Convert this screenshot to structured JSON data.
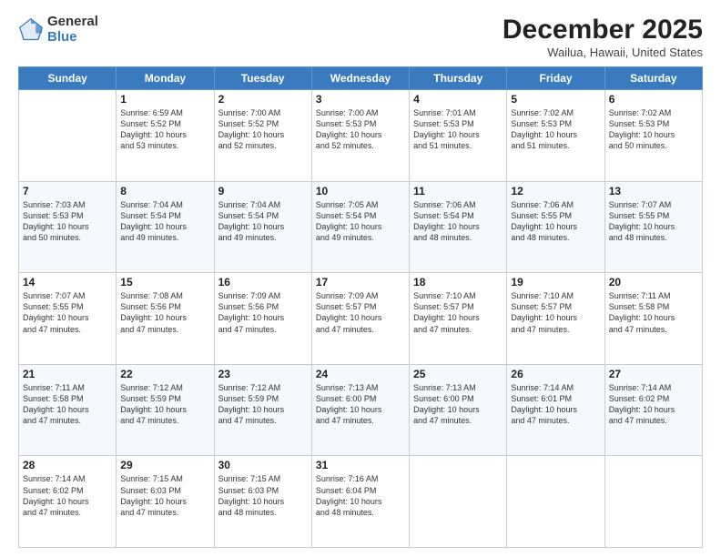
{
  "logo": {
    "general": "General",
    "blue": "Blue"
  },
  "header": {
    "month": "December 2025",
    "location": "Wailua, Hawaii, United States"
  },
  "weekdays": [
    "Sunday",
    "Monday",
    "Tuesday",
    "Wednesday",
    "Thursday",
    "Friday",
    "Saturday"
  ],
  "weeks": [
    [
      {
        "day": "",
        "info": ""
      },
      {
        "day": "1",
        "info": "Sunrise: 6:59 AM\nSunset: 5:52 PM\nDaylight: 10 hours\nand 53 minutes."
      },
      {
        "day": "2",
        "info": "Sunrise: 7:00 AM\nSunset: 5:52 PM\nDaylight: 10 hours\nand 52 minutes."
      },
      {
        "day": "3",
        "info": "Sunrise: 7:00 AM\nSunset: 5:53 PM\nDaylight: 10 hours\nand 52 minutes."
      },
      {
        "day": "4",
        "info": "Sunrise: 7:01 AM\nSunset: 5:53 PM\nDaylight: 10 hours\nand 51 minutes."
      },
      {
        "day": "5",
        "info": "Sunrise: 7:02 AM\nSunset: 5:53 PM\nDaylight: 10 hours\nand 51 minutes."
      },
      {
        "day": "6",
        "info": "Sunrise: 7:02 AM\nSunset: 5:53 PM\nDaylight: 10 hours\nand 50 minutes."
      }
    ],
    [
      {
        "day": "7",
        "info": "Sunrise: 7:03 AM\nSunset: 5:53 PM\nDaylight: 10 hours\nand 50 minutes."
      },
      {
        "day": "8",
        "info": "Sunrise: 7:04 AM\nSunset: 5:54 PM\nDaylight: 10 hours\nand 49 minutes."
      },
      {
        "day": "9",
        "info": "Sunrise: 7:04 AM\nSunset: 5:54 PM\nDaylight: 10 hours\nand 49 minutes."
      },
      {
        "day": "10",
        "info": "Sunrise: 7:05 AM\nSunset: 5:54 PM\nDaylight: 10 hours\nand 49 minutes."
      },
      {
        "day": "11",
        "info": "Sunrise: 7:06 AM\nSunset: 5:54 PM\nDaylight: 10 hours\nand 48 minutes."
      },
      {
        "day": "12",
        "info": "Sunrise: 7:06 AM\nSunset: 5:55 PM\nDaylight: 10 hours\nand 48 minutes."
      },
      {
        "day": "13",
        "info": "Sunrise: 7:07 AM\nSunset: 5:55 PM\nDaylight: 10 hours\nand 48 minutes."
      }
    ],
    [
      {
        "day": "14",
        "info": "Sunrise: 7:07 AM\nSunset: 5:55 PM\nDaylight: 10 hours\nand 47 minutes."
      },
      {
        "day": "15",
        "info": "Sunrise: 7:08 AM\nSunset: 5:56 PM\nDaylight: 10 hours\nand 47 minutes."
      },
      {
        "day": "16",
        "info": "Sunrise: 7:09 AM\nSunset: 5:56 PM\nDaylight: 10 hours\nand 47 minutes."
      },
      {
        "day": "17",
        "info": "Sunrise: 7:09 AM\nSunset: 5:57 PM\nDaylight: 10 hours\nand 47 minutes."
      },
      {
        "day": "18",
        "info": "Sunrise: 7:10 AM\nSunset: 5:57 PM\nDaylight: 10 hours\nand 47 minutes."
      },
      {
        "day": "19",
        "info": "Sunrise: 7:10 AM\nSunset: 5:57 PM\nDaylight: 10 hours\nand 47 minutes."
      },
      {
        "day": "20",
        "info": "Sunrise: 7:11 AM\nSunset: 5:58 PM\nDaylight: 10 hours\nand 47 minutes."
      }
    ],
    [
      {
        "day": "21",
        "info": "Sunrise: 7:11 AM\nSunset: 5:58 PM\nDaylight: 10 hours\nand 47 minutes."
      },
      {
        "day": "22",
        "info": "Sunrise: 7:12 AM\nSunset: 5:59 PM\nDaylight: 10 hours\nand 47 minutes."
      },
      {
        "day": "23",
        "info": "Sunrise: 7:12 AM\nSunset: 5:59 PM\nDaylight: 10 hours\nand 47 minutes."
      },
      {
        "day": "24",
        "info": "Sunrise: 7:13 AM\nSunset: 6:00 PM\nDaylight: 10 hours\nand 47 minutes."
      },
      {
        "day": "25",
        "info": "Sunrise: 7:13 AM\nSunset: 6:00 PM\nDaylight: 10 hours\nand 47 minutes."
      },
      {
        "day": "26",
        "info": "Sunrise: 7:14 AM\nSunset: 6:01 PM\nDaylight: 10 hours\nand 47 minutes."
      },
      {
        "day": "27",
        "info": "Sunrise: 7:14 AM\nSunset: 6:02 PM\nDaylight: 10 hours\nand 47 minutes."
      }
    ],
    [
      {
        "day": "28",
        "info": "Sunrise: 7:14 AM\nSunset: 6:02 PM\nDaylight: 10 hours\nand 47 minutes."
      },
      {
        "day": "29",
        "info": "Sunrise: 7:15 AM\nSunset: 6:03 PM\nDaylight: 10 hours\nand 47 minutes."
      },
      {
        "day": "30",
        "info": "Sunrise: 7:15 AM\nSunset: 6:03 PM\nDaylight: 10 hours\nand 48 minutes."
      },
      {
        "day": "31",
        "info": "Sunrise: 7:16 AM\nSunset: 6:04 PM\nDaylight: 10 hours\nand 48 minutes."
      },
      {
        "day": "",
        "info": ""
      },
      {
        "day": "",
        "info": ""
      },
      {
        "day": "",
        "info": ""
      }
    ]
  ]
}
